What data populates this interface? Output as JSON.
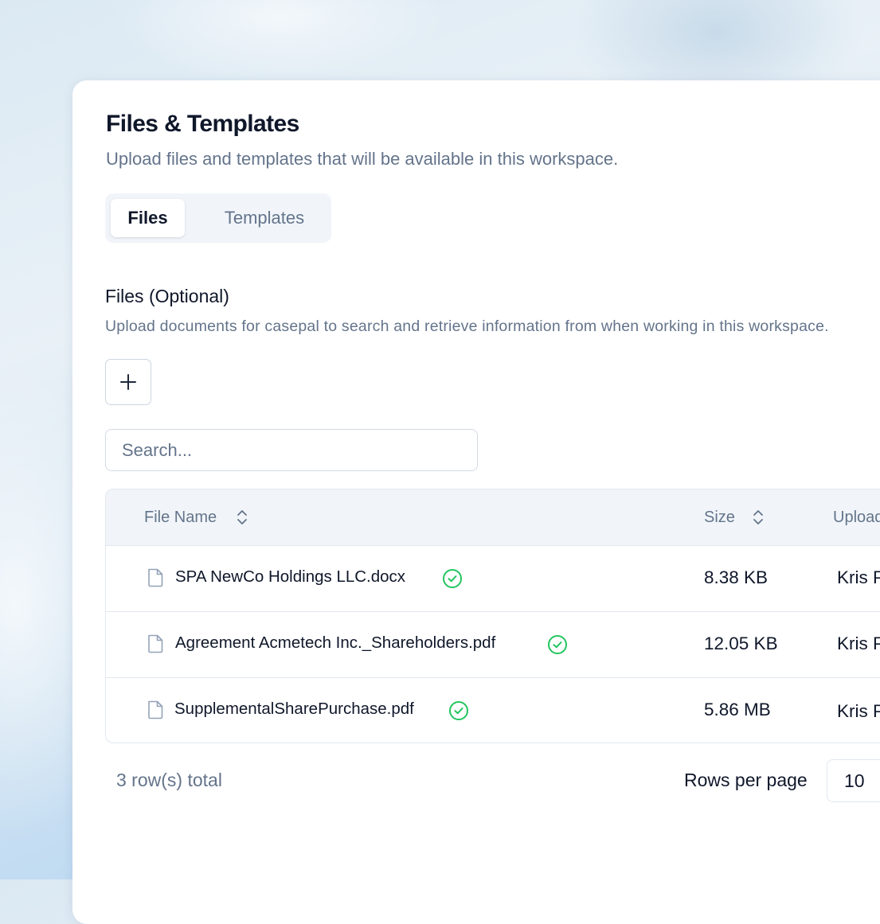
{
  "header": {
    "title": "Files & Templates",
    "subtitle": "Upload files and templates that will be available in this workspace."
  },
  "tabs": [
    {
      "label": "Files",
      "active": true
    },
    {
      "label": "Templates",
      "active": false
    }
  ],
  "files_section": {
    "title": "Files (Optional)",
    "description": "Upload documents for casepal to search and retrieve information from when working in this workspace."
  },
  "search": {
    "placeholder": "Search..."
  },
  "table": {
    "columns": [
      "File Name",
      "Size",
      "Upload"
    ],
    "rows": [
      {
        "name": "SPA NewCo Holdings LLC.docx",
        "size": "8.38 KB",
        "uploaded_by": "Kris P",
        "status": "uploaded"
      },
      {
        "name": "Agreement Acmetech Inc._Shareholders.pdf",
        "size": "12.05 KB",
        "uploaded_by": "Kris P",
        "status": "uploaded"
      },
      {
        "name": "SupplementalSharePurchase.pdf",
        "size": "5.86 MB",
        "uploaded_by": "Kris P",
        "status": "uploaded"
      }
    ]
  },
  "footer": {
    "rows_total": "3 row(s) total",
    "rows_per_page_label": "Rows per page",
    "rows_per_page_value": "10"
  },
  "colors": {
    "success": "#22c55e",
    "muted_text": "#64748b",
    "primary_text": "#0f172a",
    "border": "#e2e8f0"
  },
  "icons": {
    "add": "plus-icon",
    "sort": "chevron-up-down-icon",
    "file": "file-icon",
    "status": "check-circle-icon"
  }
}
